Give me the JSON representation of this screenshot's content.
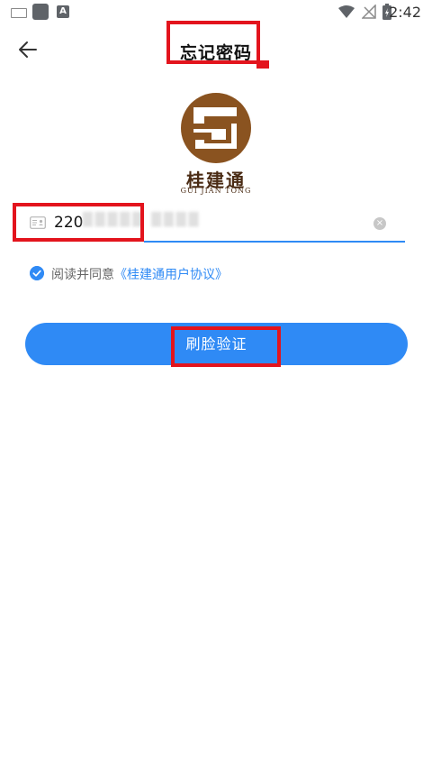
{
  "status_bar": {
    "time": "2:42"
  },
  "header": {
    "title": "忘记密码"
  },
  "logo": {
    "name_cn": "桂建通",
    "name_en": "GUI JIAN TONG"
  },
  "id_field": {
    "value": "220"
  },
  "agreement": {
    "prefix": "阅读并同意",
    "link": "《桂建通用户协议》"
  },
  "verify_button": {
    "label": "刷脸验证"
  },
  "colors": {
    "accent": "#2f8af5",
    "annotation": "#e3141d",
    "logo_brown": "#8a5320"
  }
}
